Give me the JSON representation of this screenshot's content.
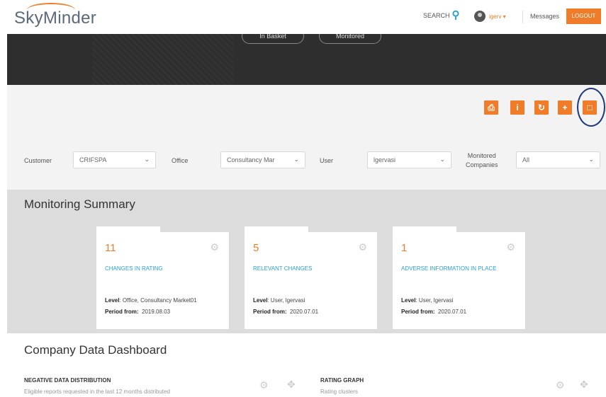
{
  "header": {
    "logo": "SkyMinder",
    "search_label": "SEARCH",
    "user_label": "igerv ▾",
    "messages": "Messages",
    "logout": "LOGOUT"
  },
  "hero": {
    "pills": [
      "In Basket",
      "Monitored"
    ]
  },
  "toolbar": {
    "icons": [
      "print-icon",
      "info-icon",
      "refresh-icon",
      "add-icon",
      "folder-icon"
    ]
  },
  "filters": {
    "customer_label": "Customer",
    "customer_value": "CRIFSPA",
    "office_label": "Office",
    "office_value": "Consultancy Mar",
    "user_label": "User",
    "user_value": "lgervasi",
    "monitored_label_1": "Monitored",
    "monitored_label_2": "Companies",
    "monitored_value": "All"
  },
  "summary": {
    "title": "Monitoring Summary",
    "cards": [
      {
        "count": "11",
        "title": "CHANGES IN RATING",
        "level_label": "Level",
        "level": ": Office, Consultancy Market01",
        "period_label": "Period from:",
        "period": "2019.08.03"
      },
      {
        "count": "5",
        "title": "RELEVANT CHANGES",
        "level_label": "Level",
        "level": ": User, lgervasi",
        "period_label": "Period from:",
        "period": "2020.07.01"
      },
      {
        "count": "1",
        "title": "ADVERSE INFORMATION IN PLACE",
        "level_label": "Level",
        "level": ": User, lgervasi",
        "period_label": "Period from:",
        "period": "2020.07.01"
      }
    ]
  },
  "dashboard": {
    "title": "Company Data Dashboard",
    "negative_title": "NEGATIVE DATA DISTRIBUTION",
    "negative_sub": "Eligible reports requested in the last 12 months distributed",
    "rating_title": "RATING GRAPH",
    "rating_sub": "Rating clusters"
  },
  "colors": {
    "accent": "#f07c2a",
    "link": "#2a9fd6",
    "highlight_ring": "#1e3a7b"
  }
}
